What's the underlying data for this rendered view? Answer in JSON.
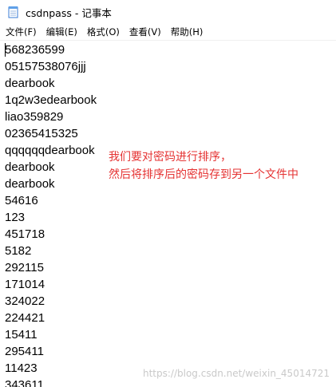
{
  "window": {
    "title": "csdnpass - 记事本",
    "icon": "notepad-icon"
  },
  "menu": {
    "items": [
      {
        "label": "文件(F)"
      },
      {
        "label": "编辑(E)"
      },
      {
        "label": "格式(O)"
      },
      {
        "label": "查看(V)"
      },
      {
        "label": "帮助(H)"
      }
    ]
  },
  "editor": {
    "lines": [
      "568236599",
      "05157538076jjj",
      "dearbook",
      "1q2w3edearbook",
      "liao359829",
      "02365415325",
      "qqqqqqdearbook",
      "dearbook",
      "dearbook",
      "54616",
      "123",
      "451718",
      "5182",
      "292115",
      "171014",
      "324022",
      "224421",
      "15411",
      "295411",
      "11423",
      "343611"
    ]
  },
  "annotation": {
    "line1": "我们要对密码进行排序，",
    "line2": "然后将排序后的密码存到另一个文件中",
    "color": "#e53333"
  },
  "watermark": {
    "text": "https://blog.csdn.net/weixin_45014721"
  }
}
